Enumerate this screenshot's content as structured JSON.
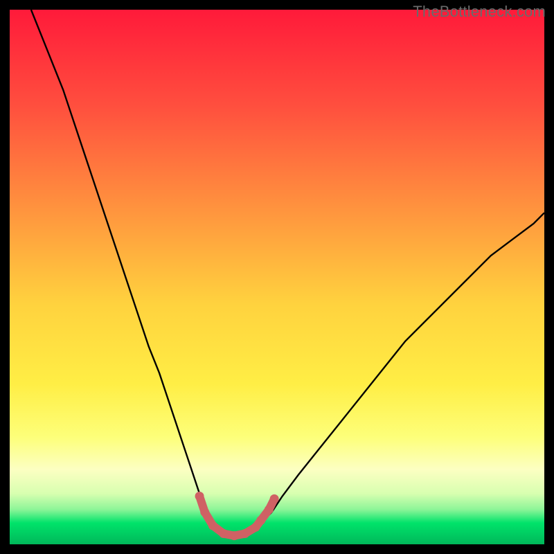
{
  "watermark": "TheBottleneck.com",
  "colors": {
    "black": "#000000",
    "curve": "#000000",
    "dot": "#cf6164",
    "grad_top": "#ff1a3a",
    "grad_mid1": "#ff823e",
    "grad_mid2": "#ffe745",
    "grad_pale": "#fcffc2",
    "grad_green": "#00e36a",
    "grad_green_deep": "#00b85a"
  },
  "chart_data": {
    "type": "line",
    "title": "",
    "xlabel": "",
    "ylabel": "",
    "xlim": [
      0,
      100
    ],
    "ylim": [
      0,
      100
    ],
    "annotations": [],
    "series": [
      {
        "name": "bottleneck-curve",
        "x": [
          4,
          6,
          8,
          10,
          12,
          14,
          16,
          18,
          20,
          22,
          24,
          26,
          28,
          30,
          32,
          33,
          34,
          35,
          36,
          37,
          38,
          39,
          40,
          41,
          42,
          43,
          44,
          45,
          46,
          47,
          49,
          51,
          54,
          58,
          62,
          66,
          70,
          74,
          78,
          82,
          86,
          90,
          94,
          98,
          100
        ],
        "y": [
          100,
          95,
          90,
          85,
          79,
          73,
          67,
          61,
          55,
          49,
          43,
          37,
          32,
          26,
          20,
          17,
          14,
          11,
          8,
          6,
          4,
          3,
          2.2,
          1.8,
          1.6,
          1.6,
          1.8,
          2.2,
          3,
          4,
          6,
          9,
          13,
          18,
          23,
          28,
          33,
          38,
          42,
          46,
          50,
          54,
          57,
          60,
          62
        ]
      }
    ],
    "marker_points": {
      "name": "trough-markers",
      "x": [
        35.5,
        36.5,
        38,
        40,
        42,
        44,
        46,
        47,
        48.5,
        49.5
      ],
      "y": [
        9,
        6,
        3.5,
        2,
        1.6,
        2,
        3.2,
        4.5,
        6.5,
        8.5
      ]
    },
    "gradient_stops": [
      {
        "offset": 0.0,
        "color": "#ff1a3a"
      },
      {
        "offset": 0.18,
        "color": "#ff4f3e"
      },
      {
        "offset": 0.38,
        "color": "#ff963e"
      },
      {
        "offset": 0.55,
        "color": "#ffd23e"
      },
      {
        "offset": 0.7,
        "color": "#ffee45"
      },
      {
        "offset": 0.8,
        "color": "#fdff7a"
      },
      {
        "offset": 0.86,
        "color": "#fcffc2"
      },
      {
        "offset": 0.905,
        "color": "#d8ffb0"
      },
      {
        "offset": 0.935,
        "color": "#8cf598"
      },
      {
        "offset": 0.96,
        "color": "#00e36a"
      },
      {
        "offset": 1.0,
        "color": "#00b85a"
      }
    ]
  }
}
